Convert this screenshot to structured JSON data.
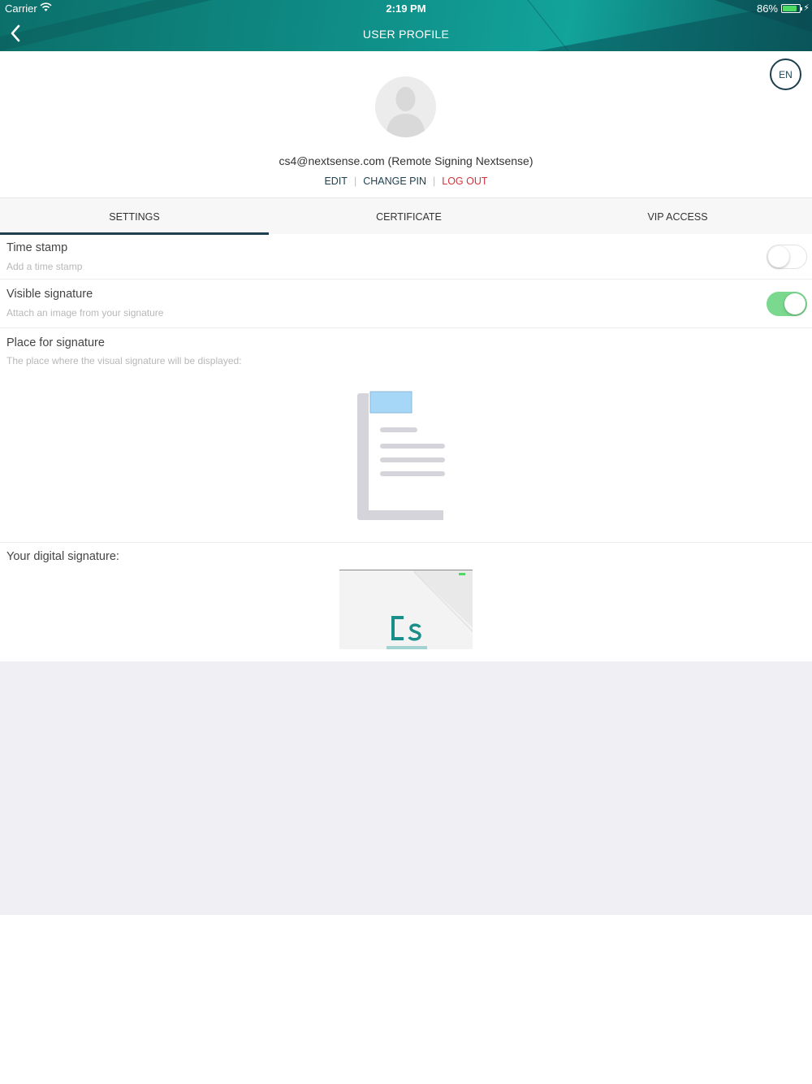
{
  "status_bar": {
    "carrier": "Carrier",
    "time": "2:19 PM",
    "battery_percent": "86%",
    "battery_level": 0.86
  },
  "nav": {
    "title": "USER PROFILE",
    "back_icon": "chevron-left-icon"
  },
  "profile": {
    "language_button": "EN",
    "user_label": "cs4@nextsense.com (Remote Signing Nextsense)",
    "actions": {
      "edit": "EDIT",
      "change_pin": "CHANGE PIN",
      "logout": "LOG OUT"
    }
  },
  "tabs": [
    {
      "label": "SETTINGS",
      "active": true
    },
    {
      "label": "CERTIFICATE",
      "active": false
    },
    {
      "label": "VIP ACCESS",
      "active": false
    }
  ],
  "settings": {
    "time_stamp": {
      "title": "Time stamp",
      "subtitle": "Add a time stamp",
      "enabled": false
    },
    "visible_signature": {
      "title": "Visible signature",
      "subtitle": "Attach an image from your signature",
      "enabled": true
    },
    "place_for_signature": {
      "title": "Place for signature",
      "subtitle": "The place where the visual signature will be displayed:"
    },
    "digital_signature": {
      "title": "Your digital signature:"
    }
  },
  "colors": {
    "header_teal": "#0f8f88",
    "accent_dark": "#1d3f4e",
    "logout_red": "#d0353a",
    "toggle_on": "#7ad98f",
    "signature_box": "#a7d7f7"
  }
}
